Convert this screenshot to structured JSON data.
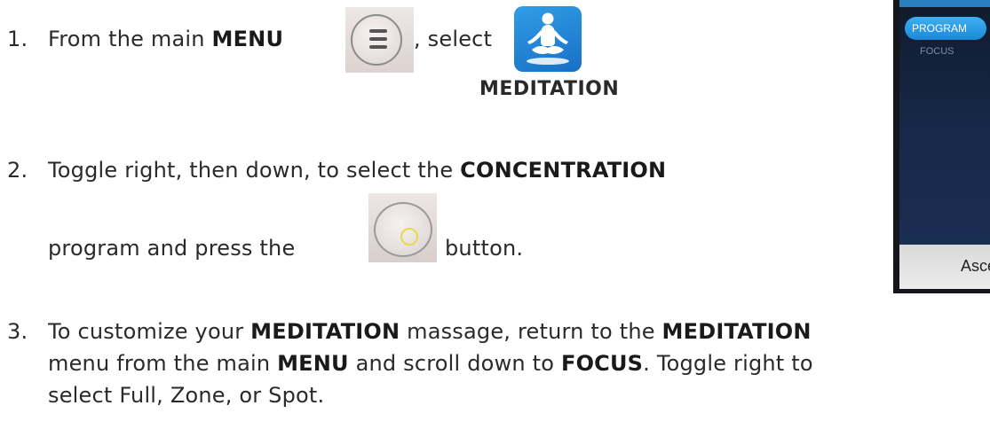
{
  "steps": [
    {
      "number": "1.",
      "text_a": "From the main ",
      "bold_a": "MENU",
      "text_b": ", select",
      "icon_caption": "MEDITATION"
    },
    {
      "number": "2.",
      "text_a": "Toggle right, then down, to select the ",
      "bold_a": "CONCENTRATION",
      "text_b": "program and press the",
      "text_c": "button."
    },
    {
      "number": "3.",
      "text_a": "To customize your ",
      "bold_a": "MEDITATION",
      "text_b": " massage, return to the ",
      "bold_b": "MEDITATION",
      "text_c": "menu from the main ",
      "bold_c": "MENU",
      "text_d": " and scroll down to ",
      "bold_d": "FOCUS",
      "text_e": ". Toggle right to",
      "text_f": "select Full, Zone, or Spot."
    }
  ],
  "icons": {
    "menu": "menu-icon",
    "meditation": "meditation-icon",
    "select": "select-button-icon"
  },
  "remote_screen": {
    "pill_label": "PROGRAM",
    "item_label": "FOCUS",
    "bottom_text": "Asce"
  },
  "colors": {
    "meditation_icon_bg": "#1f86d8",
    "select_dot": "#e8d84a",
    "panel_bg": "#14161b",
    "pill_bg": "#2b9be6"
  }
}
